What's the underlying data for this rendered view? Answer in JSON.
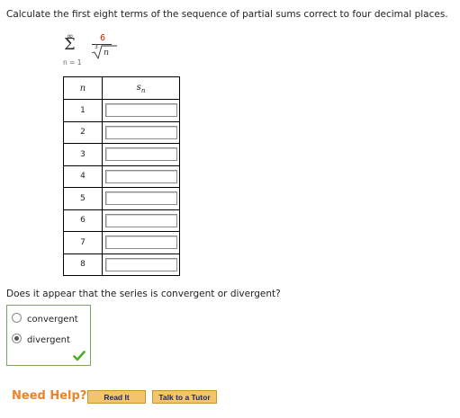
{
  "question": "Calculate the first eight terms of the sequence of partial sums correct to four decimal places.",
  "series": {
    "upper_limit": "∞",
    "sigma": "Σ",
    "lower_limit": "n = 1",
    "numerator": "6",
    "root_index": "3",
    "radicand": "n"
  },
  "table": {
    "col_n_header": "n",
    "col_s_header": "s",
    "col_s_sub": "n",
    "rows": [
      "1",
      "2",
      "3",
      "4",
      "5",
      "6",
      "7",
      "8"
    ],
    "values": [
      "",
      "",
      "",
      "",
      "",
      "",
      "",
      ""
    ]
  },
  "question2": "Does it appear that the series is convergent or divergent?",
  "choices": {
    "convergent": "convergent",
    "divergent": "divergent",
    "selected": "divergent"
  },
  "help": {
    "label": "Need Help?",
    "read_button": "Read It",
    "tutor_button": "Talk to a Tutor"
  },
  "colors": {
    "numerator": "#cc2200",
    "correct_border": "#7aa85a",
    "check": "#4caf28",
    "help_label": "#e8852a",
    "button_bg": "#f3c46a"
  }
}
